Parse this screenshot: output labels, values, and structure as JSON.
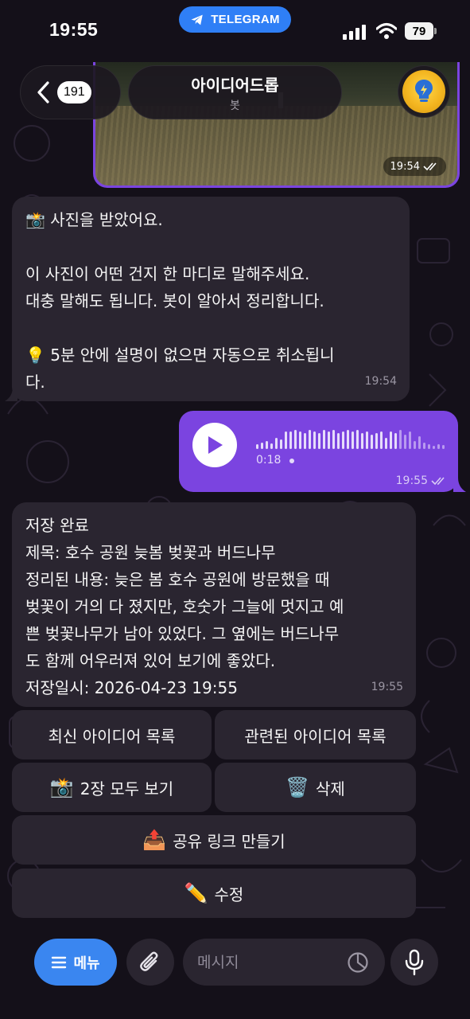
{
  "status_bar": {
    "time": "19:55",
    "app_badge": "TELEGRAM",
    "battery": "79"
  },
  "header": {
    "back_count": "191",
    "title": "아이디어드롭",
    "subtitle": "봇",
    "avatar_icon": "lightbulb-icon"
  },
  "messages": [
    {
      "type": "photo",
      "direction": "outgoing",
      "time": "19:54",
      "status": "read"
    },
    {
      "type": "text",
      "direction": "incoming",
      "lines": [
        "📸 사진을 받았어요.",
        "",
        "이 사진이 어떤 건지 한 마디로 말해주세요.",
        "대충 말해도 됩니다. 봇이 알아서 정리합니다.",
        "",
        "💡 5분 안에 설명이 없으면 자동으로 취소됩니",
        "다."
      ],
      "time": "19:54"
    },
    {
      "type": "voice",
      "direction": "outgoing",
      "duration": "0:18",
      "time": "19:55",
      "status": "read"
    },
    {
      "type": "text",
      "direction": "incoming",
      "lines": [
        "저장 완료",
        "제목: 호수 공원 늦봄 벚꽃과 버드나무",
        "정리된 내용: 늦은 봄 호수 공원에 방문했을 때",
        "벚꽃이 거의 다 졌지만, 호숫가 그늘에 멋지고 예",
        "쁜 벚꽃나무가 남아 있었다. 그 옆에는 버드나무",
        "도 함께 어우러져 있어 보기에 좋았다.",
        "저장일시: 2026-04-23 19:55"
      ],
      "time": "19:55"
    }
  ],
  "inline_keyboard": {
    "latest_ideas": "최신 아이디어 목록",
    "related_ideas": "관련된 아이디어 목록",
    "view_all": {
      "emoji": "📸",
      "label": "2장 모두 보기"
    },
    "delete": {
      "emoji": "🗑️",
      "label": "삭제"
    },
    "share_link": {
      "emoji": "📤",
      "label": "공유 링크 만들기"
    },
    "edit": {
      "emoji": "✏️",
      "label": "수정"
    }
  },
  "composer": {
    "menu_label": "메뉴",
    "placeholder": "메시지"
  },
  "colors": {
    "background": "#141019",
    "incoming_bubble": "#2a2530",
    "outgoing_bubble": "#7b44e0",
    "accent_blue": "#3a86f0",
    "telegram_badge": "#2f7ff6"
  }
}
